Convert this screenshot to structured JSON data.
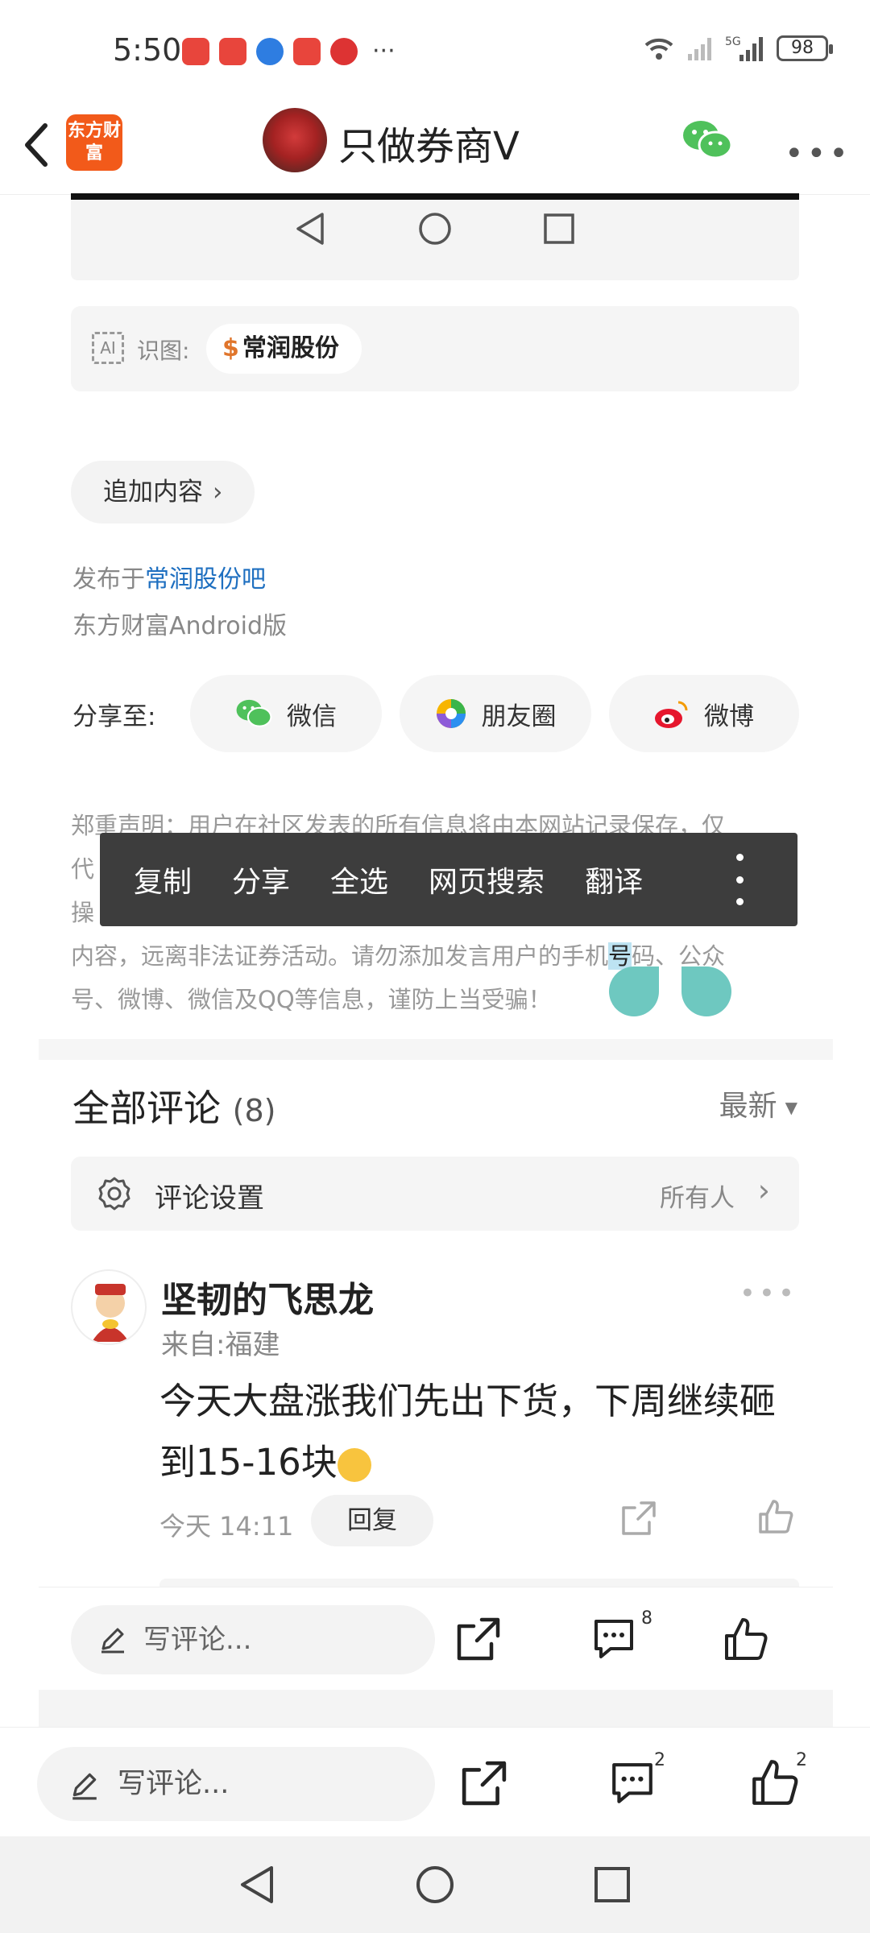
{
  "status_bar": {
    "time": "5:50",
    "battery": "98",
    "network": "5G"
  },
  "header": {
    "logo_text": "东方财富",
    "title": "只做券商V"
  },
  "ai_recognize": {
    "label": "识图:",
    "stock": "常润股份",
    "stock_symbol": "$"
  },
  "add_content": {
    "label": "追加内容",
    "chevron": "›"
  },
  "publish": {
    "prefix": "发布于",
    "bar_link": "常润股份吧",
    "client": "东方财富Android版"
  },
  "share": {
    "label": "分享至:",
    "wechat": "微信",
    "moments": "朋友圈",
    "weibo": "微博"
  },
  "disclaimer": {
    "line1": "郑重声明：用户在社区发表的所有信息将由本网站记录保存，仅",
    "line2": "代",
    "line3": "操",
    "line4_before": "内容，远离非法证券活动。请勿添加发言用户的手机",
    "line4_selected": "号",
    "line4_after": "码、公众",
    "line5": "号、微博、微信及QQ等信息，谨防上当受骗！"
  },
  "context_menu": {
    "copy": "复制",
    "share": "分享",
    "select_all": "全选",
    "web_search": "网页搜索",
    "translate": "翻译"
  },
  "comments": {
    "title": "全部评论",
    "count": "(8)",
    "sort": "最新",
    "settings_label": "评论设置",
    "settings_value": "所有人"
  },
  "comment": {
    "author": "坚韧的飞思龙",
    "location": "来自:福建",
    "text_line1": "今天大盘涨我们先出下货，下周继续砸",
    "text_line2": "到15-16块",
    "time": "今天 14:11",
    "reply": "回复"
  },
  "inner_bar": {
    "placeholder": "写评论...",
    "comment_badge": "8"
  },
  "bottom_bar": {
    "placeholder": "写评论...",
    "comment_badge": "2",
    "like_badge": "2"
  },
  "colors": {
    "brand_orange": "#f25a1a",
    "link_blue": "#1e6fc0",
    "selection_handle": "#6ec8c0",
    "context_menu_bg": "#3d3d3d"
  }
}
